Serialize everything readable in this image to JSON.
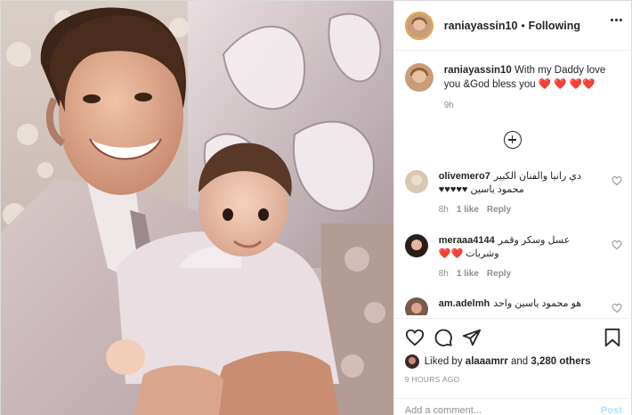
{
  "post": {
    "username": "raniayassin10",
    "separator": "•",
    "follow_status": "Following",
    "caption": "With my Daddy love you &God bless you ❤️ ❤️ ❤️❤️",
    "caption_time": "9h",
    "likes_prefix": "Liked by",
    "liked_by_user": "alaaamrr",
    "likes_and": "and",
    "likes_others": "3,280 others",
    "posted_ago": "9 HOURS AGO",
    "add_comment_placeholder": "Add a comment...",
    "post_button": "Post"
  },
  "comments": [
    {
      "user": "olivemero7",
      "text": "دي رانيا والفنان الكبير محمود ياسين ♥♥♥♥♥",
      "time": "8h",
      "likes": "1 like",
      "reply": "Reply"
    },
    {
      "user": "meraaa4144",
      "text": "عسل وسكر وقمر وشربات ❤️❤️",
      "time": "8h",
      "likes": "1 like",
      "reply": "Reply"
    },
    {
      "user": "am.adelmh",
      "text": "هو محمود ياسين واحد بس"
    }
  ]
}
